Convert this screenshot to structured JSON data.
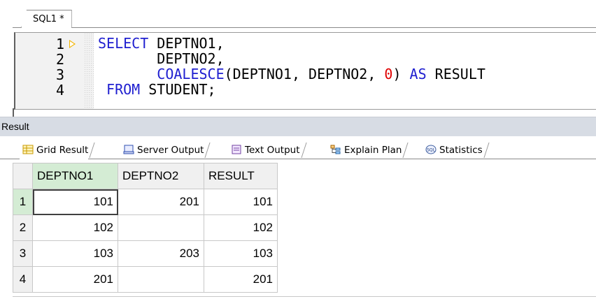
{
  "editor": {
    "tab_label": "SQL1 *",
    "lines": [
      {
        "number": "1",
        "parts": [
          {
            "t": "SELECT",
            "c": "kw"
          },
          {
            "t": " DEPTNO1,",
            "c": ""
          }
        ]
      },
      {
        "number": "2",
        "parts": [
          {
            "t": "       DEPTNO2,",
            "c": ""
          }
        ]
      },
      {
        "number": "3",
        "parts": [
          {
            "t": "       ",
            "c": ""
          },
          {
            "t": "COALESCE",
            "c": "fn"
          },
          {
            "t": "(DEPTNO1, DEPTNO2, ",
            "c": ""
          },
          {
            "t": "0",
            "c": "num"
          },
          {
            "t": ") ",
            "c": ""
          },
          {
            "t": "AS",
            "c": "kw"
          },
          {
            "t": " RESULT",
            "c": ""
          }
        ]
      },
      {
        "number": "4",
        "parts": [
          {
            "t": " FROM",
            "c": "kw"
          },
          {
            "t": " STUDENT;",
            "c": ""
          }
        ]
      }
    ]
  },
  "result_panel": {
    "title": "Result",
    "tabs": [
      {
        "label": "Grid Result",
        "icon": "grid-icon",
        "active": true
      },
      {
        "label": "Server Output",
        "icon": "server-output-icon",
        "active": false
      },
      {
        "label": "Text Output",
        "icon": "text-output-icon",
        "active": false
      },
      {
        "label": "Explain Plan",
        "icon": "explain-plan-icon",
        "active": false
      },
      {
        "label": "Statistics",
        "icon": "statistics-icon",
        "active": false
      }
    ]
  },
  "grid": {
    "columns": [
      "DEPTNO1",
      "DEPTNO2",
      "RESULT"
    ],
    "rows": [
      {
        "num": "1",
        "cells": [
          "101",
          "201",
          "101"
        ]
      },
      {
        "num": "2",
        "cells": [
          "102",
          "",
          "102"
        ]
      },
      {
        "num": "3",
        "cells": [
          "103",
          "203",
          "103"
        ]
      },
      {
        "num": "4",
        "cells": [
          "201",
          "",
          "201"
        ]
      }
    ]
  },
  "colors": {
    "keyword": "#2020d0",
    "number_literal": "#e00000",
    "selected_header": "#d4ecd4",
    "result_bar": "#d7dce4"
  }
}
